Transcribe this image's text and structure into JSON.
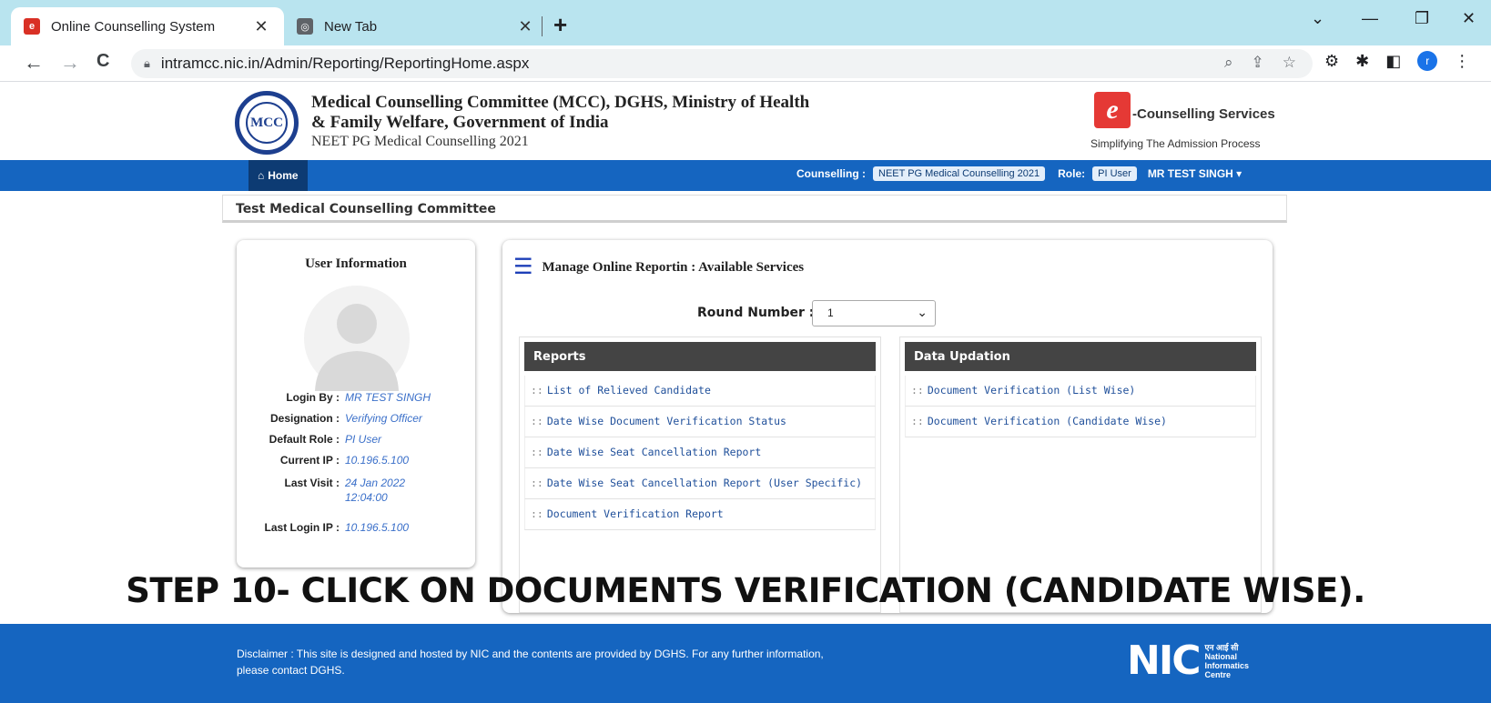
{
  "browser": {
    "tabs": [
      {
        "title": "Online Counselling System",
        "close": "✕",
        "favicon_color": "#d93025",
        "favicon_glyph": "e"
      },
      {
        "title": "New Tab",
        "close": "✕",
        "favicon_color": "#5f6368",
        "favicon_glyph": "◎"
      }
    ],
    "new_tab": "+",
    "window_controls": {
      "dropdown": "⌄",
      "minimize": "—",
      "restore": "❐",
      "close": "✕"
    },
    "back": "←",
    "forward": "→",
    "reload": "C",
    "url": "intramcc.nic.in/Admin/Reporting/ReportingHome.aspx",
    "profile_initial": "r"
  },
  "header": {
    "logo_text": "MCC",
    "line1": "Medical Counselling Committee (MCC), DGHS, Ministry of Health",
    "line2": "& Family Welfare, Government of India",
    "line3": "NEET PG Medical Counselling 2021",
    "ec_logo": "e",
    "ec_title": "-Counselling Services",
    "ec_tagline": "Simplifying The Admission Process"
  },
  "nav": {
    "home": "Home",
    "counselling_label": "Counselling :",
    "counselling_value": "NEET PG Medical Counselling 2021",
    "role_label": "Role:",
    "role_value": "PI User",
    "user": "MR TEST SINGH ▾"
  },
  "org_name": "Test Medical Counselling Committee",
  "user_info": {
    "title": "User Information",
    "rows": [
      {
        "label": "Login By :",
        "value": "MR TEST SINGH"
      },
      {
        "label": "Designation :",
        "value": "Verifying Officer"
      },
      {
        "label": "Default Role :",
        "value": "PI User"
      },
      {
        "label": "Current IP :",
        "value": "10.196.5.100"
      },
      {
        "label": "Last Visit :",
        "value": "24 Jan 2022 12:04:00"
      },
      {
        "label": "Last Login IP :",
        "value": "10.196.5.100"
      }
    ]
  },
  "services": {
    "title": "Manage Online Reportin : Available Services",
    "round_label": "Round Number :",
    "round_value": "1",
    "reports": {
      "header": "Reports",
      "items": [
        "List of Relieved Candidate",
        "Date Wise Document Verification Status",
        "Date Wise Seat Cancellation Report",
        "Date Wise Seat Cancellation Report (User Specific)",
        "Document Verification Report"
      ]
    },
    "data_updation": {
      "header": "Data Updation",
      "items": [
        "Document Verification (List Wise)",
        "Document Verification (Candidate Wise)"
      ]
    }
  },
  "caption": "STEP 10- CLICK ON DOCUMENTS VERIFICATION (CANDIDATE WISE).",
  "footer": {
    "disclaimer": "Disclaimer : This site is designed and hosted by NIC and the contents are provided by DGHS. For any further information, please contact DGHS.",
    "nic_word": "NIC",
    "nic_hindi": "एन आई सी",
    "nic_sub1": "National",
    "nic_sub2": "Informatics",
    "nic_sub3": "Centre"
  }
}
